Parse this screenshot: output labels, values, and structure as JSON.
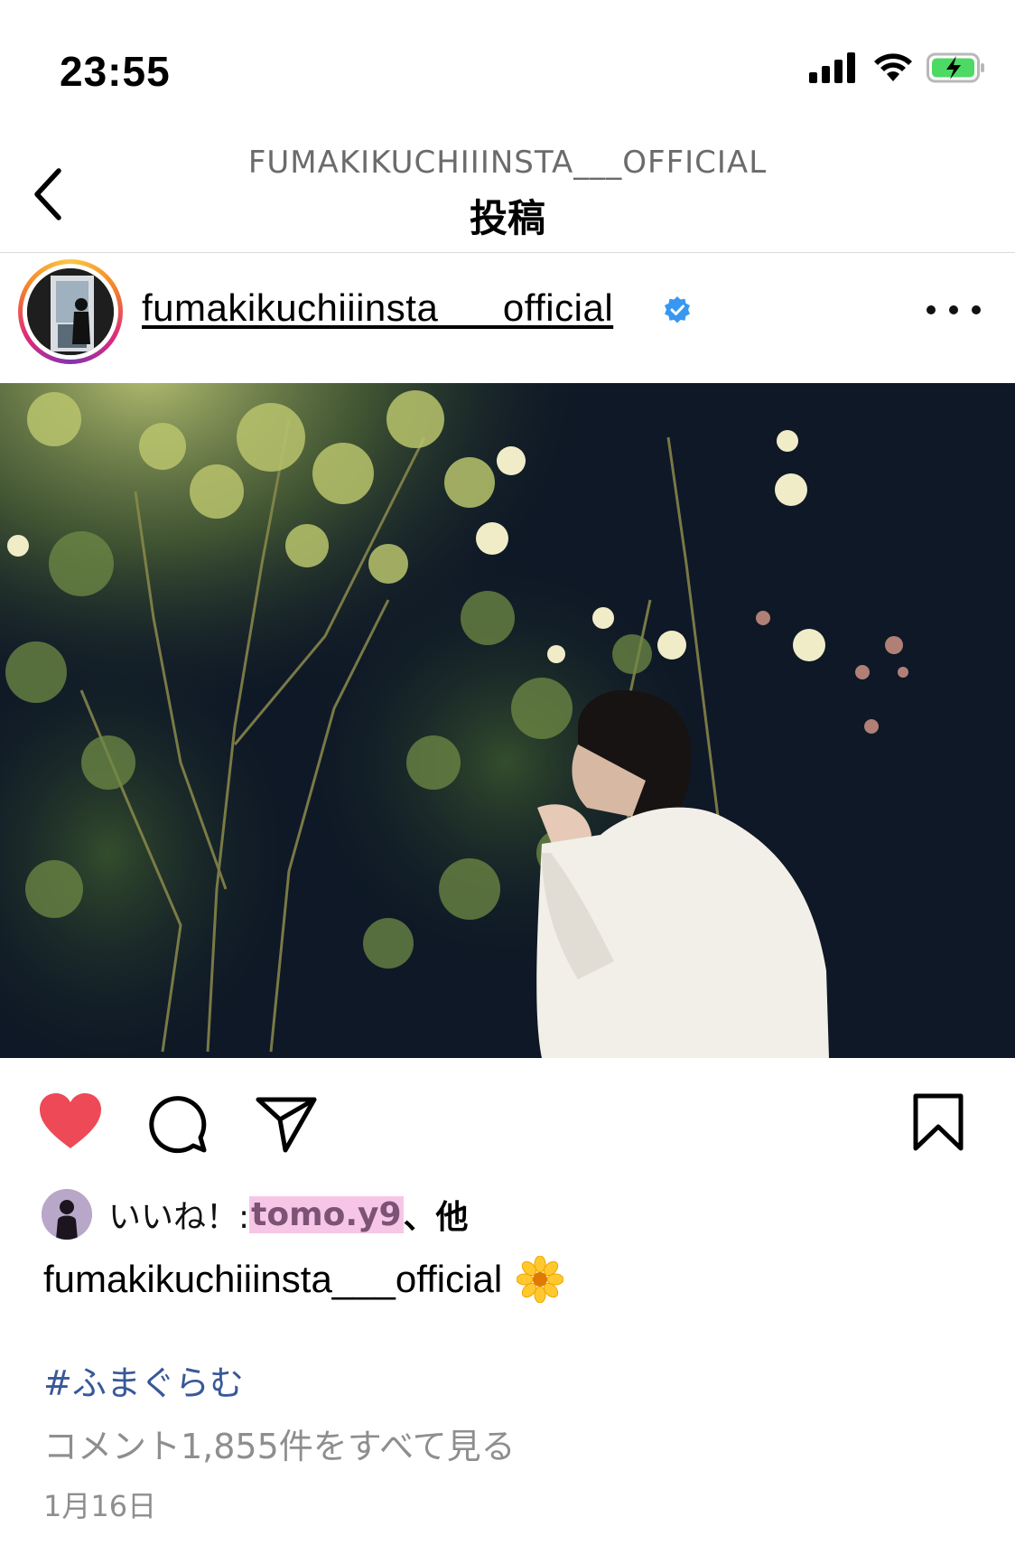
{
  "status_bar": {
    "time": "23:55",
    "icons": [
      "signal-icon",
      "wifi-icon",
      "battery-charging-icon"
    ],
    "battery_color": "#4cd964"
  },
  "header": {
    "account_name": "FUMAKIKUCHIIINSTA___OFFICIAL",
    "title": "投稿",
    "back_icon": "chevron-left-icon"
  },
  "post": {
    "username": "fumakikuchiiinsta___official",
    "verified_color": "#3897f0",
    "more_icon": "more-horizontal-icon",
    "image_description_icon": "photo",
    "actions": {
      "like_icon": "heart-filled-icon",
      "like_color": "#ed4956",
      "comment_icon": "comment-icon",
      "share_icon": "send-icon",
      "save_icon": "bookmark-icon"
    },
    "likes": {
      "prefix": "いいね！: ",
      "user": "tomo.y9",
      "suffix": "、他"
    },
    "caption": {
      "username": "fumakikuchiiinsta___official",
      "emoji": "🌼"
    },
    "hashtag": "#ふまぐらむ",
    "comments_link": "コメント1,855件をすべて見る",
    "date": "1月16日"
  },
  "colors": {
    "hashtag": "#385898",
    "secondary_text": "#8e8e8e",
    "likes_highlight": "#f7c6e6"
  }
}
